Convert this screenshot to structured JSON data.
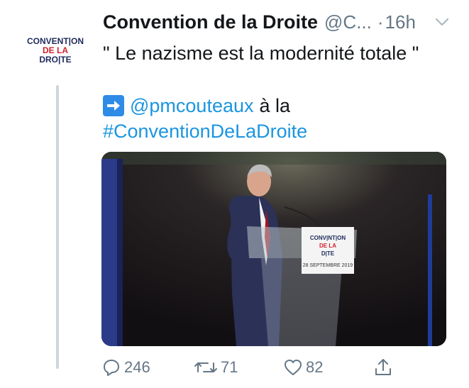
{
  "tweet": {
    "author_name": "Convention de la Droite",
    "author_handle": "@C...",
    "separator": "·",
    "timestamp": "16h",
    "text": "\" Le nazisme est la modernité totale \"",
    "body_mention": "@pmcouteaux",
    "body_plain": "à la",
    "body_hashtag": "#ConventionDeLaDroite"
  },
  "avatar_logo": {
    "line1": "CONVENT|ON",
    "line2": "DE LA",
    "line3": "DRO|TE"
  },
  "media": {
    "podium_sign_line1": "CONV|NT|ON",
    "podium_sign_line2": "DE LA",
    "podium_sign_line3": "D|TE",
    "podium_date": "28 SEPTEMBRE 2019"
  },
  "actions": {
    "replies": "246",
    "retweets": "71",
    "likes": "82"
  },
  "colors": {
    "link_blue": "#1b95e0",
    "muted_gray": "#657786",
    "thread_line": "#ccd6dd",
    "logo_navy": "#1f2a5c",
    "logo_red": "#d21f2a"
  },
  "icons": {
    "caret": "chevron-down-icon",
    "arrow": "right-arrow-emoji-icon",
    "reply": "reply-icon",
    "retweet": "retweet-icon",
    "like": "heart-icon",
    "share": "share-icon"
  }
}
